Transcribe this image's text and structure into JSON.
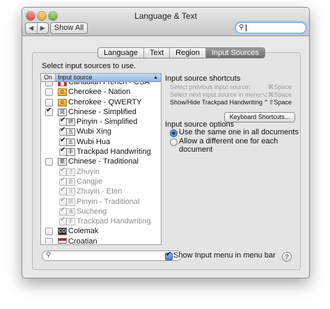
{
  "window": {
    "title": "Language & Text"
  },
  "toolbar": {
    "show_all_label": "Show All",
    "back_glyph": "◀",
    "forward_glyph": "▶",
    "search_value": ""
  },
  "tabs": [
    {
      "label": "Language",
      "active": false
    },
    {
      "label": "Text",
      "active": false
    },
    {
      "label": "Region",
      "active": false
    },
    {
      "label": "Input Sources",
      "active": true
    }
  ],
  "main": {
    "instruction": "Select input sources to use.",
    "list": {
      "header_on": "On",
      "header_source": "Input source",
      "items": [
        {
          "label": "Canadian French - CSA",
          "checked": false,
          "indent": false,
          "disabled": false,
          "icon": "canada-flag-icon",
          "glyph": ""
        },
        {
          "label": "Cherokee - Nation",
          "checked": false,
          "indent": false,
          "disabled": false,
          "icon": "cherokee-icon",
          "glyph": "Ꮳ"
        },
        {
          "label": "Cherokee - QWERTY",
          "checked": false,
          "indent": false,
          "disabled": false,
          "icon": "cherokee-icon",
          "glyph": "Ꮳ"
        },
        {
          "label": "Chinese - Simplified",
          "checked": true,
          "indent": false,
          "disabled": false,
          "icon": "chinese-icon",
          "glyph": "简"
        },
        {
          "label": "Pinyin - Simplified",
          "checked": true,
          "indent": true,
          "disabled": false,
          "icon": "pinyin-icon",
          "glyph": "拼"
        },
        {
          "label": "Wubi Xing",
          "checked": true,
          "indent": true,
          "disabled": false,
          "icon": "wubi-icon",
          "glyph": "五"
        },
        {
          "label": "Wubi Hua",
          "checked": true,
          "indent": true,
          "disabled": false,
          "icon": "wubi-icon",
          "glyph": "五"
        },
        {
          "label": "Trackpad Handwriting",
          "checked": true,
          "indent": true,
          "disabled": false,
          "icon": "handwriting-icon",
          "glyph": "手"
        },
        {
          "label": "Chinese - Traditional",
          "checked": false,
          "indent": false,
          "disabled": false,
          "icon": "chinese-icon",
          "glyph": "繁"
        },
        {
          "label": "Zhuyin",
          "checked": true,
          "indent": true,
          "disabled": true,
          "icon": "zhuyin-icon",
          "glyph": "注"
        },
        {
          "label": "Cangjie",
          "checked": true,
          "indent": true,
          "disabled": true,
          "icon": "cangjie-icon",
          "glyph": "倉"
        },
        {
          "label": "Zhuyin - Eten",
          "checked": true,
          "indent": true,
          "disabled": true,
          "icon": "zhuyin-icon",
          "glyph": "注"
        },
        {
          "label": "Pinyin - Traditional",
          "checked": true,
          "indent": true,
          "disabled": true,
          "icon": "pinyin-icon",
          "glyph": "拼"
        },
        {
          "label": "Sucheng",
          "checked": true,
          "indent": true,
          "disabled": true,
          "icon": "sucheng-icon",
          "glyph": "速"
        },
        {
          "label": "Trackpad Handwriting",
          "checked": true,
          "indent": true,
          "disabled": true,
          "icon": "handwriting-icon",
          "glyph": "手"
        },
        {
          "label": "Colemak",
          "checked": false,
          "indent": false,
          "disabled": false,
          "icon": "colemak-icon",
          "glyph": "CO"
        },
        {
          "label": "Croatian",
          "checked": false,
          "indent": false,
          "disabled": false,
          "icon": "croatia-flag-icon",
          "glyph": ""
        }
      ]
    },
    "shortcuts": {
      "heading": "Input source shortcuts",
      "rows": [
        {
          "label": "Select previous input source:",
          "key": "⌘Space",
          "enabled": false
        },
        {
          "label": "Select next input source in menu:",
          "key": "⌥⌘Space",
          "enabled": false
        },
        {
          "label": "Show/Hide Trackpad Handwriting",
          "key": "⌃⇧Space",
          "enabled": true
        }
      ],
      "button_label": "Keyboard Shortcuts..."
    },
    "options": {
      "heading": "Input source options",
      "radios": [
        {
          "label": "Use the same one in all documents",
          "selected": true
        },
        {
          "label": "Allow a different one for each document",
          "selected": false
        }
      ]
    },
    "bottom": {
      "search_value": "",
      "show_menu_checked": true,
      "show_menu_label": "Show Input menu in menu bar",
      "help_label": "?"
    }
  },
  "colors": {
    "selected_tab": "#7d7d7d",
    "list_header_selected": "#9bbbe6",
    "accent": "#4a7fcd"
  }
}
